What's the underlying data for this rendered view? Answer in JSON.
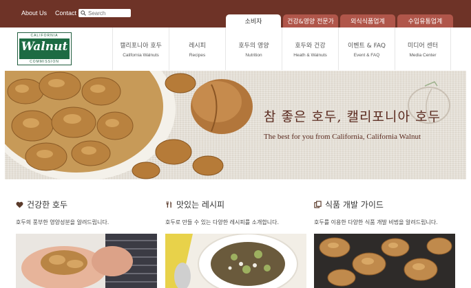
{
  "top_links": [
    "About Us",
    "Contact Us"
  ],
  "search": {
    "placeholder": "Search"
  },
  "audience_tabs": [
    {
      "label": "소비자",
      "active": true
    },
    {
      "label": "건강&영양 전문가",
      "active": false
    },
    {
      "label": "외식식품업계",
      "active": false
    },
    {
      "label": "수입유통업계",
      "active": false
    }
  ],
  "logo": {
    "top": "CALIFORNIA",
    "word": "Walnut",
    "bottom": "COMMISSION"
  },
  "menu": [
    {
      "ko": "캘리포니아 호두",
      "en": "California Walnuts"
    },
    {
      "ko": "레시피",
      "en": "Recipes"
    },
    {
      "ko": "호두의 영양",
      "en": "Nutrition"
    },
    {
      "ko": "호두와 건강",
      "en": "Heath & Walnuts"
    },
    {
      "ko": "이벤트 & FAQ",
      "en": "Event & FAQ"
    },
    {
      "ko": "미디어 센터",
      "en": "Media Center"
    }
  ],
  "hero": {
    "headline": "참 좋은 호두, 캘리포니아 호두",
    "sub": "The best for you from California, California Walnut"
  },
  "sections": [
    {
      "icon": "heart-icon",
      "title": "건강한 호두",
      "desc": "호두의 풍부한 영양성분을 알려드립니다."
    },
    {
      "icon": "utensils-icon",
      "title": "맛있는 레시피",
      "desc": "호두로 만들 수 있는 다양한 레시피를 소개합니다."
    },
    {
      "icon": "copy-icon",
      "title": "식품 개발 가이드",
      "desc": "호두를 이용한 다양한 식품 개발 비법을 알려드립니다."
    }
  ],
  "colors": {
    "brand_brown": "#6e3327",
    "tab_red": "#b0564a",
    "logo_green": "#1d6b43"
  }
}
